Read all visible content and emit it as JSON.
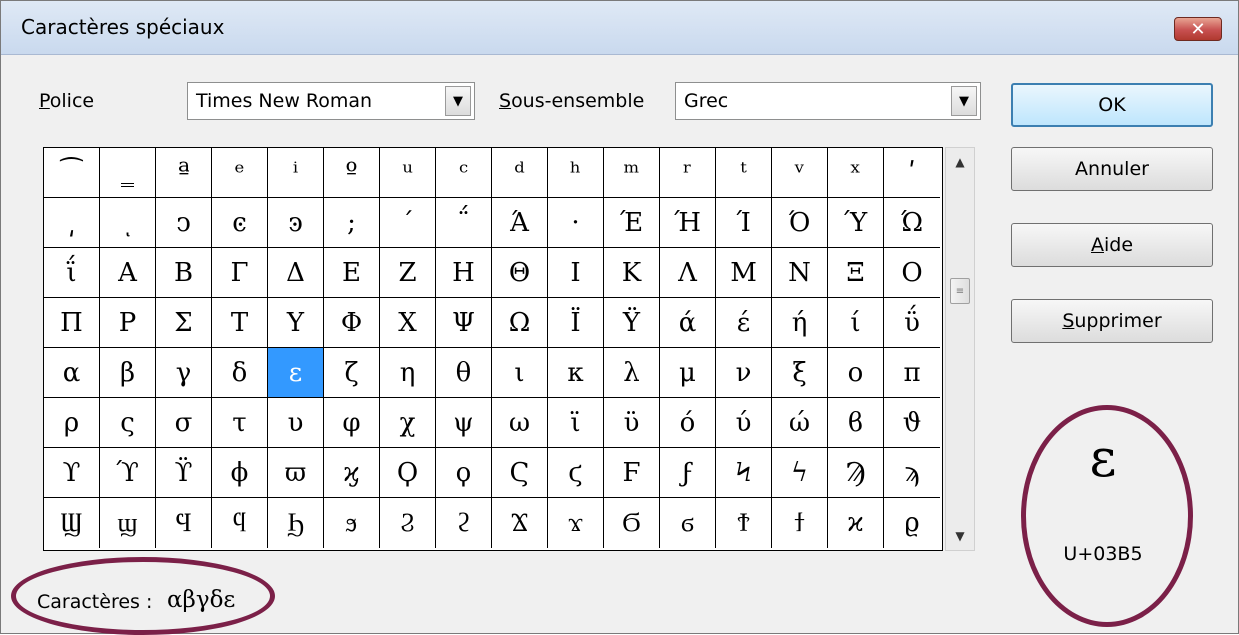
{
  "window": {
    "title": "Caractères spéciaux",
    "close_glyph": "✕"
  },
  "font": {
    "label": "Police",
    "value": "Times New Roman"
  },
  "subset": {
    "label": "Sous-ensemble",
    "value": "Grec"
  },
  "buttons": {
    "ok": "OK",
    "cancel": "Annuler",
    "help": "Aide",
    "delete": "Supprimer"
  },
  "grid": {
    "rows": [
      [
        "⁀",
        "‗",
        "ª",
        "ᵉ",
        "ⁱ",
        "º",
        "ᵘ",
        "ᶜ",
        "ᵈ",
        "ʰ",
        "ᵐ",
        "ʳ",
        "ᵗ",
        "ᵛ",
        "ˣ",
        "ʹ"
      ],
      [
        "͵",
        "ͺ",
        "ͻ",
        "ͼ",
        "ͽ",
        ";",
        "΄",
        "΅",
        "Ά",
        "·",
        "Έ",
        "Ή",
        "Ί",
        "Ό",
        "Ύ",
        "Ώ"
      ],
      [
        "ΐ",
        "Α",
        "Β",
        "Γ",
        "Δ",
        "Ε",
        "Ζ",
        "Η",
        "Θ",
        "Ι",
        "Κ",
        "Λ",
        "Μ",
        "Ν",
        "Ξ",
        "Ο"
      ],
      [
        "Π",
        "Ρ",
        "Σ",
        "Τ",
        "Υ",
        "Φ",
        "Χ",
        "Ψ",
        "Ω",
        "Ϊ",
        "Ϋ",
        "ά",
        "έ",
        "ή",
        "ί",
        "ΰ"
      ],
      [
        "α",
        "β",
        "γ",
        "δ",
        "ε",
        "ζ",
        "η",
        "θ",
        "ι",
        "κ",
        "λ",
        "μ",
        "ν",
        "ξ",
        "ο",
        "π"
      ],
      [
        "ρ",
        "ς",
        "σ",
        "τ",
        "υ",
        "φ",
        "χ",
        "ψ",
        "ω",
        "ϊ",
        "ϋ",
        "ό",
        "ύ",
        "ώ",
        "ϐ",
        "ϑ"
      ],
      [
        "ϒ",
        "ϓ",
        "ϔ",
        "ϕ",
        "ϖ",
        "ϗ",
        "Ϙ",
        "ϙ",
        "Ϛ",
        "ϛ",
        "Ϝ",
        "ϝ",
        "Ϟ",
        "ϟ",
        "Ϡ",
        "ϡ"
      ],
      [
        "Ϣ",
        "ϣ",
        "Ϥ",
        "ϥ",
        "Ϧ",
        "ϧ",
        "Ϩ",
        "ϩ",
        "Ϫ",
        "ϫ",
        "Ϭ",
        "ϭ",
        "Ϯ",
        "ϯ",
        "ϰ",
        "ϱ"
      ]
    ],
    "selected_row": 4,
    "selected_col": 4
  },
  "preview": {
    "char": "ε",
    "code": "U+03B5"
  },
  "characters": {
    "label": "Caractères :",
    "value": "αβγδε"
  },
  "colors": {
    "selection": "#3399ff",
    "annotation": "#7b2048"
  },
  "icons": {
    "combo_arrow": "dropdown-arrow-icon",
    "scroll_up": "scroll-up-icon",
    "scroll_down": "scroll-down-icon"
  }
}
